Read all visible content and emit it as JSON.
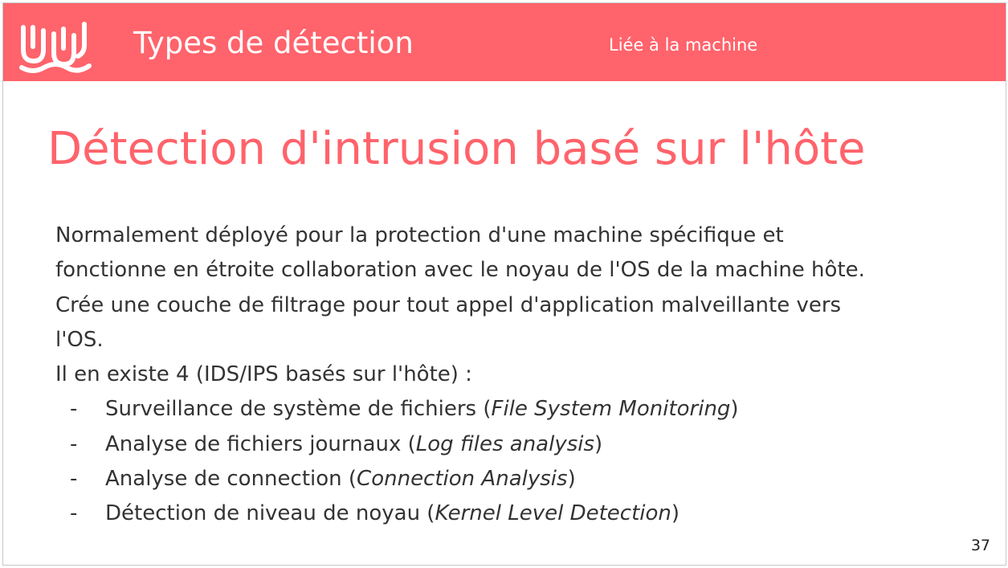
{
  "header": {
    "title": "Types de détection",
    "subtitle": "Liée à la machine",
    "logo_icon": "wave-logo-icon",
    "background_color": "#ff636b"
  },
  "slide": {
    "title": "Détection d'intrusion basé sur l'hôte",
    "title_color": "#ff636b",
    "paragraphs": [
      "Normalement déployé pour la protection d'une machine spécifique et",
      "fonctionne en étroite collaboration avec le noyau de l'OS de la machine hôte.",
      "Crée une couche de filtrage pour tout appel d'application malveillante vers",
      "l'OS.",
      "Il en existe 4 (IDS/IPS basés sur l'hôte) :"
    ],
    "bullet_marker": "-",
    "bullets": [
      {
        "text": "Surveillance de système de fichiers (",
        "italic": "File System Monitoring",
        "end": ")"
      },
      {
        "text": "Analyse de fichiers journaux (",
        "italic": "Log files analysis",
        "end": ")"
      },
      {
        "text": "Analyse de connection (",
        "italic": "Connection Analysis",
        "end": ")"
      },
      {
        "text": "Détection de niveau de noyau (",
        "italic": "Kernel Level Detection",
        "end": ")"
      }
    ],
    "page_number": "37"
  }
}
